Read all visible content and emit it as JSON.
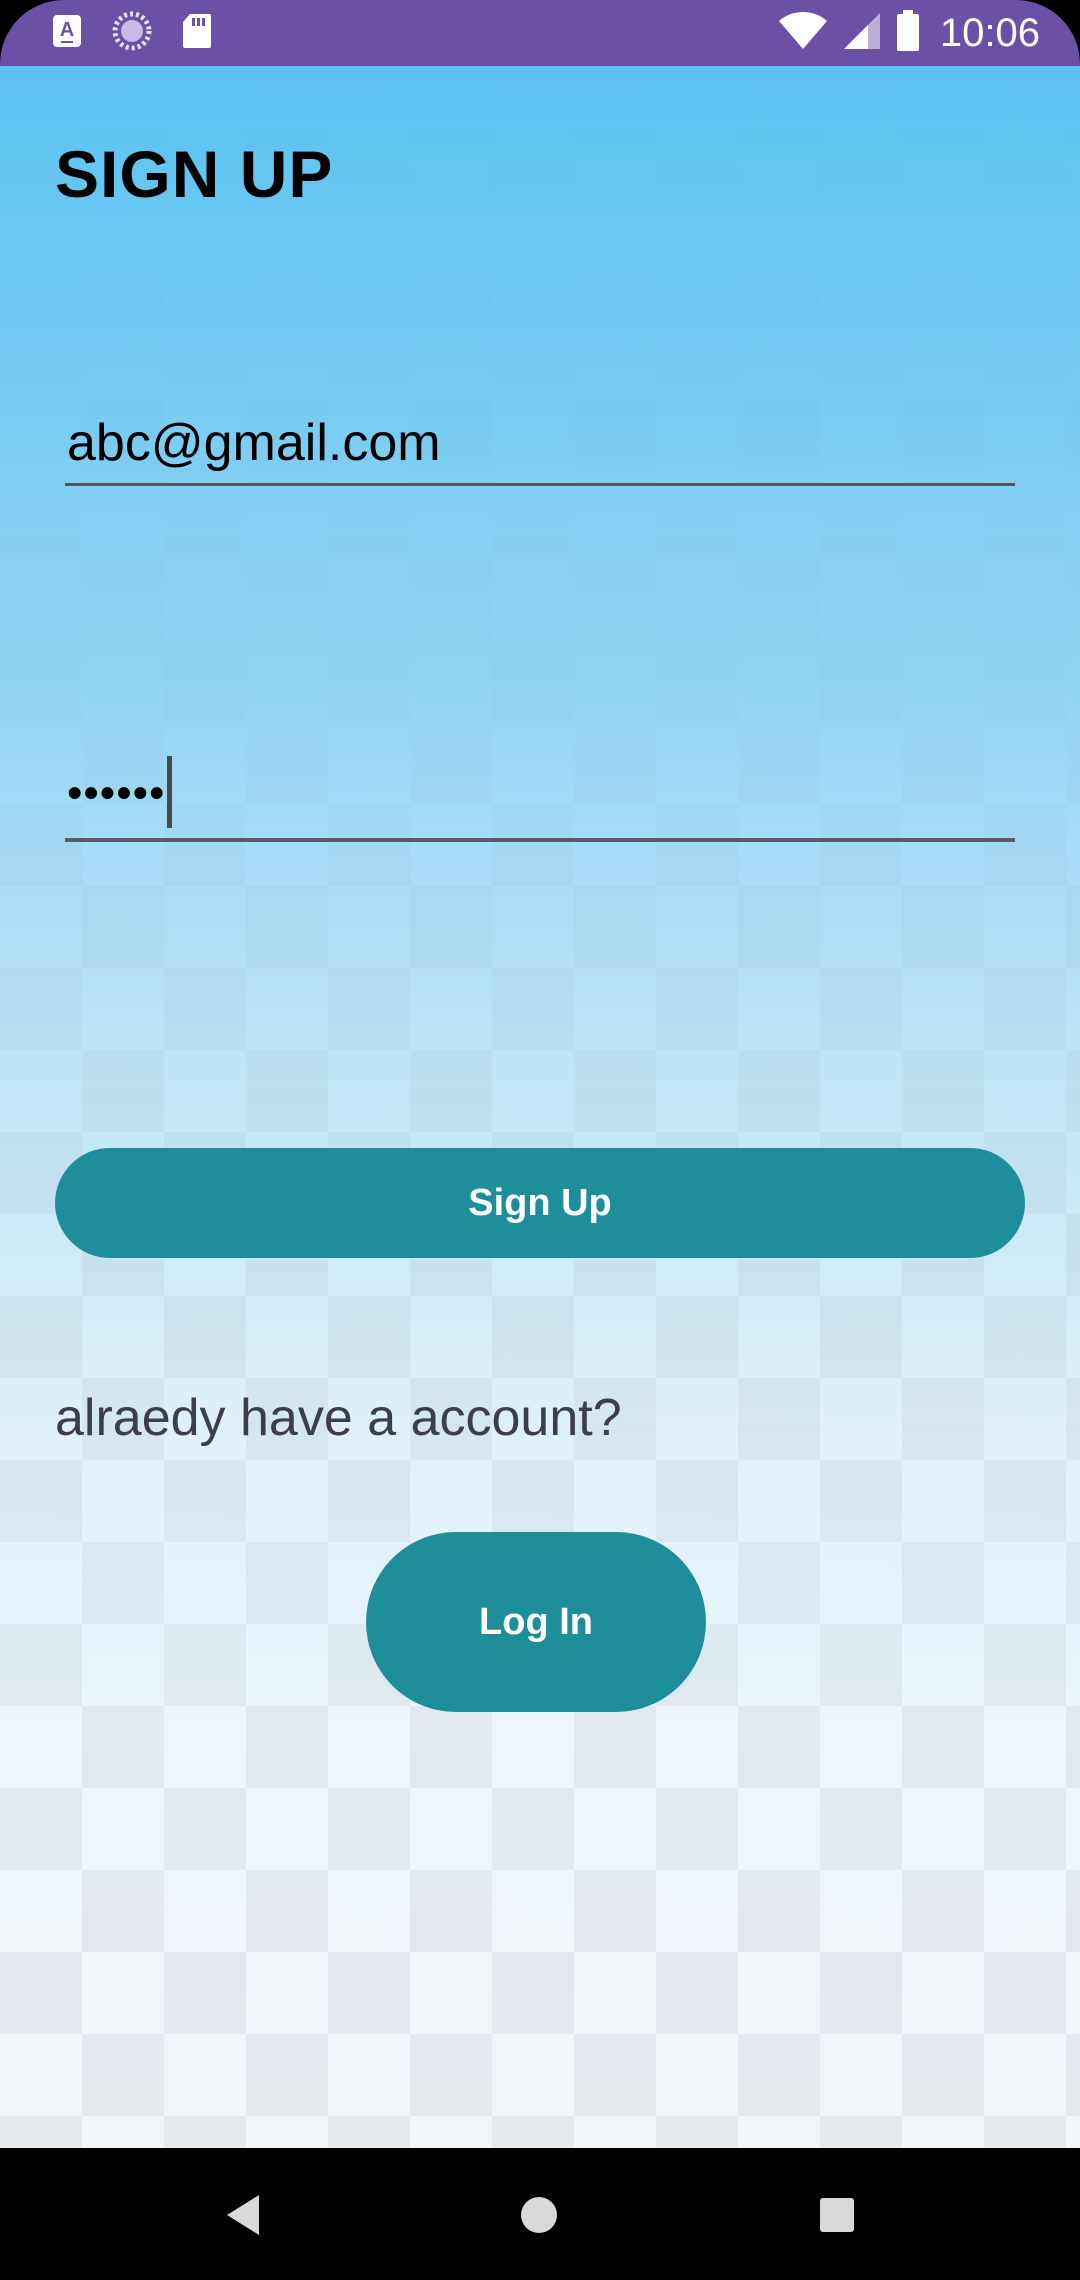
{
  "status_bar": {
    "time": "10:06",
    "left_icons": [
      "keyboard-a-icon",
      "loading-circle-icon",
      "sd-card-icon"
    ],
    "right_icons": [
      "wifi-icon",
      "cellular-signal-icon",
      "battery-icon"
    ],
    "background": "#6a51a6"
  },
  "screen": {
    "title": "SIGN UP",
    "email_field": {
      "value": "abc@gmail.com"
    },
    "password_field": {
      "value": "••••••"
    },
    "signup_button_label": "Sign Up",
    "account_prompt": "alraedy have a account?",
    "login_button_label": "Log In",
    "accent_color": "#1e8e9b"
  },
  "nav_bar": {
    "buttons": [
      "back-icon",
      "home-icon",
      "recents-icon"
    ]
  }
}
